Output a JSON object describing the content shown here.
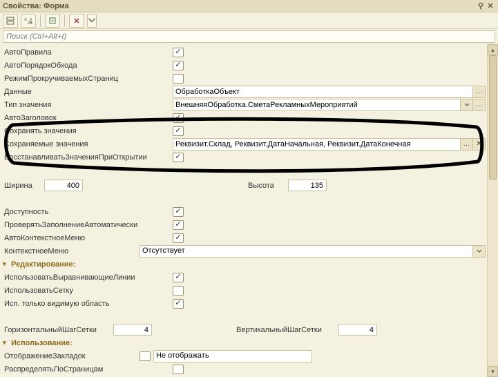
{
  "window": {
    "title": "Свойства: Форма"
  },
  "search": {
    "placeholder": "Поиск (Ctrl+Alt+I)"
  },
  "rows": {
    "autoRules": "АвтоПравила",
    "autoBypassOrder": "АвтоПорядокОбхода",
    "scrollPagesMode": "РежимПрокручиваемыхСтраниц",
    "dataLbl": "Данные",
    "dataVal": "ОбработкаОбъект",
    "valueTypeLbl": "Тип значения",
    "valueTypeVal": "ВнешняяОбработка.СметаРекламныхМероприятий",
    "autoTitle": "АвтоЗаголовок",
    "saveValues": "Сохранять значения",
    "savedValuesLbl": "Сохраняемые значения",
    "savedValuesVal": "Реквизит.Склад, Реквизит.ДатаНачальная, Реквизит.ДатаКонечная",
    "restoreOnOpen": "ВосстанавливатьЗначенияПриОткрытии",
    "widthLbl": "Ширина",
    "widthVal": "400",
    "heightLbl": "Высота",
    "heightVal": "135",
    "availability": "Доступность",
    "autoCheckFill": "ПроверятьЗаполнениеАвтоматически",
    "autoCtxMenu": "АвтоКонтекстноеМеню",
    "ctxMenuLbl": "КонтекстноеМеню",
    "ctxMenuVal": "Отсутствует",
    "sectEdit": "Редактирование:",
    "useAlignLines": "ИспользоватьВыравнивающиеЛинии",
    "useGrid": "ИспользоватьСетку",
    "useVisibleOnly": "Исп. только видимую область",
    "hGridStepLbl": "ГоризонтальныйШагСетки",
    "hGridStepVal": "4",
    "vGridStepLbl": "ВертикальныйШагСетки",
    "vGridStepVal": "4",
    "sectUsage": "Использование:",
    "tabDisplayLbl": "ОтображениеЗакладок",
    "tabDisplayVal": "Не отображать",
    "distribByPages": "РаспределятьПоСтраницам"
  }
}
